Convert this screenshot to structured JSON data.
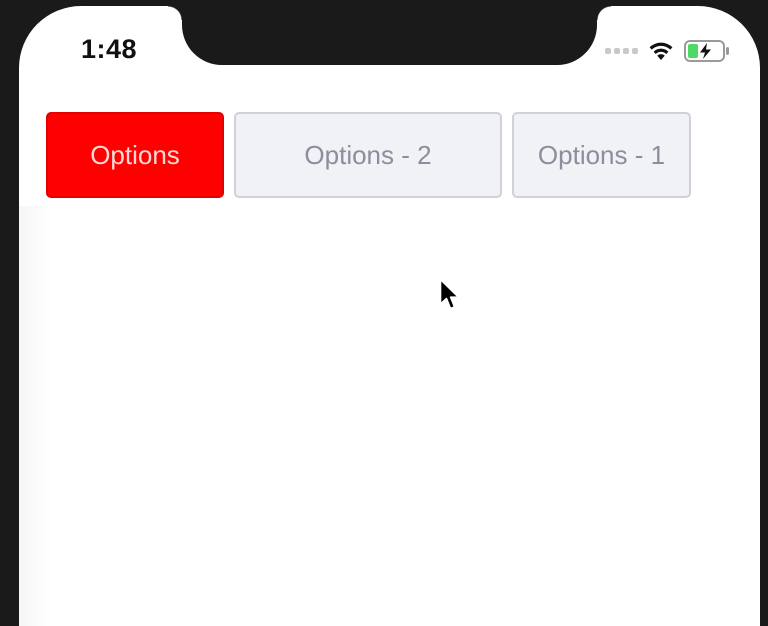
{
  "status_bar": {
    "time": "1:48",
    "icons": [
      "cellular-signal-icon",
      "wifi-icon",
      "battery-charging-icon"
    ]
  },
  "segmented_control": {
    "tabs": [
      {
        "label": "Options",
        "selected": true
      },
      {
        "label": "Options - 2",
        "selected": false
      },
      {
        "label": "Options - 1",
        "selected": false
      }
    ]
  },
  "colors": {
    "selected_background": "#ff0000",
    "unselected_background": "#f1f2f6",
    "unselected_text": "#8a8f9c",
    "battery_fill": "#4cd964"
  }
}
